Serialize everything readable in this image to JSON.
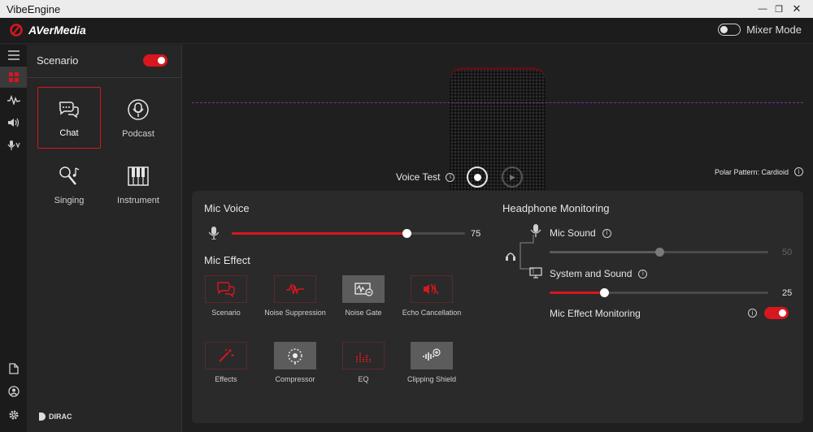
{
  "window": {
    "title": "VibeEngine"
  },
  "header": {
    "brand": "AVerMedia",
    "mixer_mode_label": "Mixer Mode",
    "mixer_mode_on": false
  },
  "scenario": {
    "title": "Scenario",
    "enabled": true,
    "items": [
      {
        "label": "Chat",
        "icon": "chat-icon",
        "active": true
      },
      {
        "label": "Podcast",
        "icon": "podcast-mic-icon",
        "active": false
      },
      {
        "label": "Singing",
        "icon": "singing-mic-icon",
        "active": false
      },
      {
        "label": "Instrument",
        "icon": "piano-icon",
        "active": false
      }
    ],
    "footer_logo": "DIRAC"
  },
  "main": {
    "voice_test_label": "Voice Test",
    "polar_label": "Polar Pattern: Cardioid",
    "mic_voice": {
      "title": "Mic Voice",
      "value": "75",
      "level": 0.75
    },
    "mic_effect": {
      "title": "Mic Effect",
      "items": [
        {
          "label": "Scenario",
          "icon": "chat-icon",
          "enabled": true
        },
        {
          "label": "Noise Suppression",
          "icon": "noise-suppression-icon",
          "enabled": true
        },
        {
          "label": "Noise Gate",
          "icon": "noise-gate-icon",
          "enabled": false
        },
        {
          "label": "Echo Cancellation",
          "icon": "echo-cancellation-icon",
          "enabled": true
        },
        {
          "label": "Effects",
          "icon": "magic-wand-icon",
          "enabled": true
        },
        {
          "label": "Compressor",
          "icon": "compressor-icon",
          "enabled": false
        },
        {
          "label": "EQ",
          "icon": "eq-icon",
          "enabled": true
        },
        {
          "label": "Clipping Shield",
          "icon": "clipping-shield-icon",
          "enabled": false
        }
      ]
    },
    "headphone": {
      "title": "Headphone Monitoring",
      "mic_sound": {
        "label": "Mic Sound",
        "value": "50",
        "level": 0.5,
        "enabled": false
      },
      "system_sound": {
        "label": "System and Sound",
        "value": "25",
        "level": 0.25,
        "enabled": true
      },
      "mic_effect_monitoring": {
        "label": "Mic Effect Monitoring",
        "enabled": true
      }
    }
  },
  "colors": {
    "accent": "#d8161f",
    "background": "#1f1f1f",
    "panel": "#262626",
    "card": "#2a2a2a"
  }
}
